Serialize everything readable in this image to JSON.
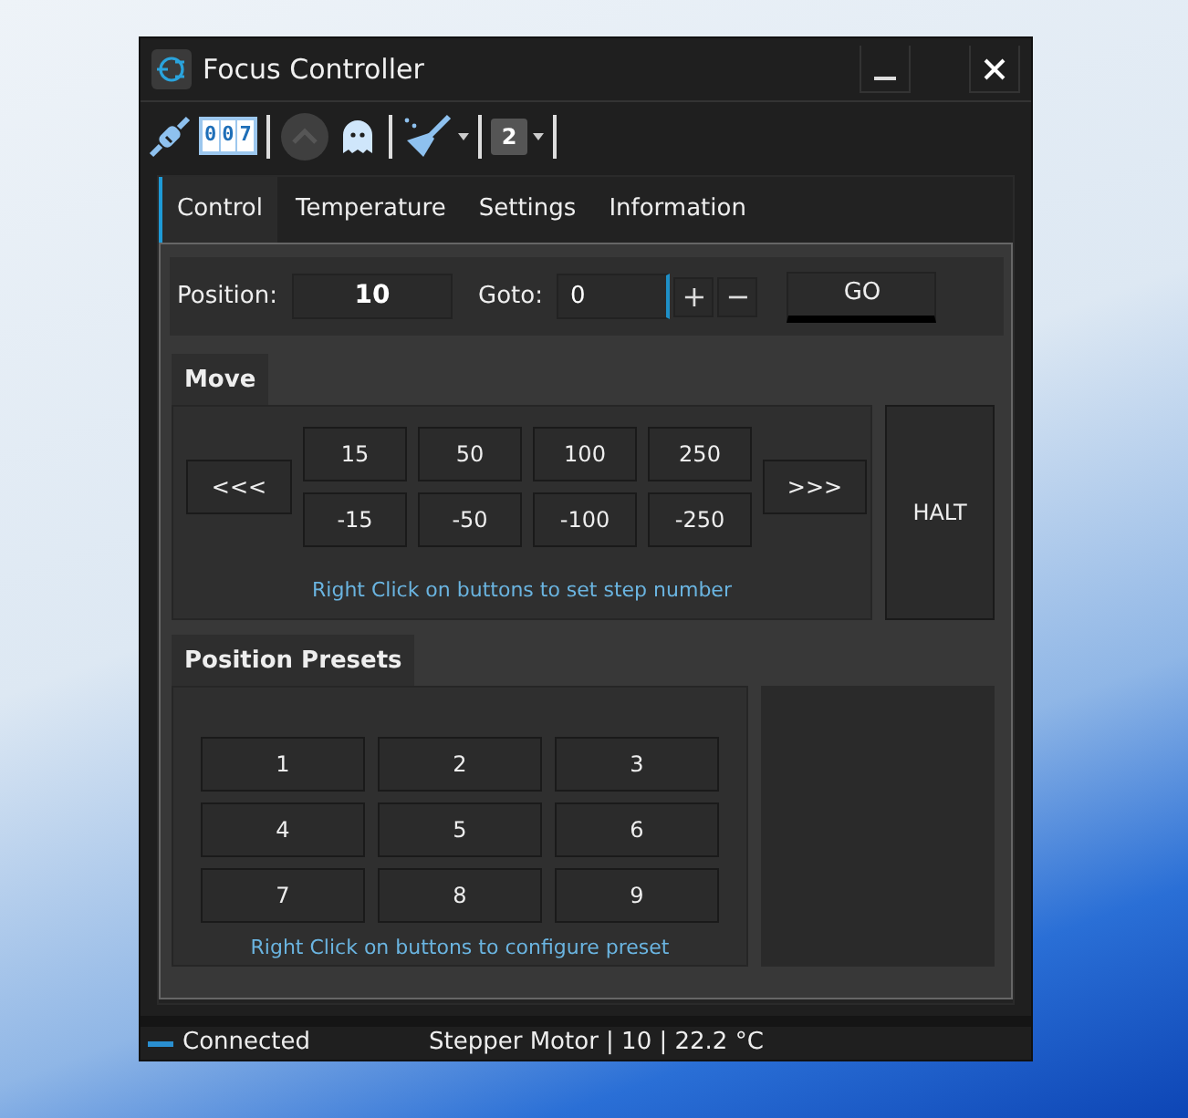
{
  "window": {
    "title": "Focus Controller"
  },
  "toolbar": [
    {
      "kind": "plug",
      "disabled": false
    },
    {
      "kind": "counter",
      "text": "007",
      "disabled": false
    },
    {
      "kind": "separator"
    },
    {
      "kind": "up",
      "disabled": true
    },
    {
      "kind": "ghost",
      "disabled": false
    },
    {
      "kind": "separator"
    },
    {
      "kind": "broom",
      "dropdown": true,
      "disabled": false
    },
    {
      "kind": "separator"
    },
    {
      "kind": "number",
      "text": "2",
      "dropdown": true,
      "disabled": false
    },
    {
      "kind": "separator"
    }
  ],
  "tabs": [
    {
      "label": "Control",
      "selected": true
    },
    {
      "label": "Temperature",
      "selected": false
    },
    {
      "label": "Settings",
      "selected": false
    },
    {
      "label": "Information",
      "selected": false
    }
  ],
  "position": {
    "label": "Position:",
    "value": "10"
  },
  "goto": {
    "label": "Goto:",
    "value": "0",
    "plus": "+",
    "minus": "−",
    "button": "GO"
  },
  "move": {
    "title": "Move",
    "left": "<<<",
    "right": ">>>",
    "steps": [
      "15",
      "50",
      "100",
      "250"
    ],
    "negative_steps": [
      "-15",
      "-50",
      "-100",
      "-250"
    ],
    "halt": "HALT",
    "hint": "Right Click on buttons to set step number"
  },
  "presets": {
    "title": "Position Presets",
    "buttons": [
      "1",
      "2",
      "3",
      "4",
      "5",
      "6",
      "7",
      "8",
      "9"
    ],
    "hint": "Right Click on buttons to configure preset"
  },
  "status_bar": {
    "connected": true,
    "connection": "Connected",
    "info": "Stepper Motor | 10 | 22.2 °C"
  }
}
